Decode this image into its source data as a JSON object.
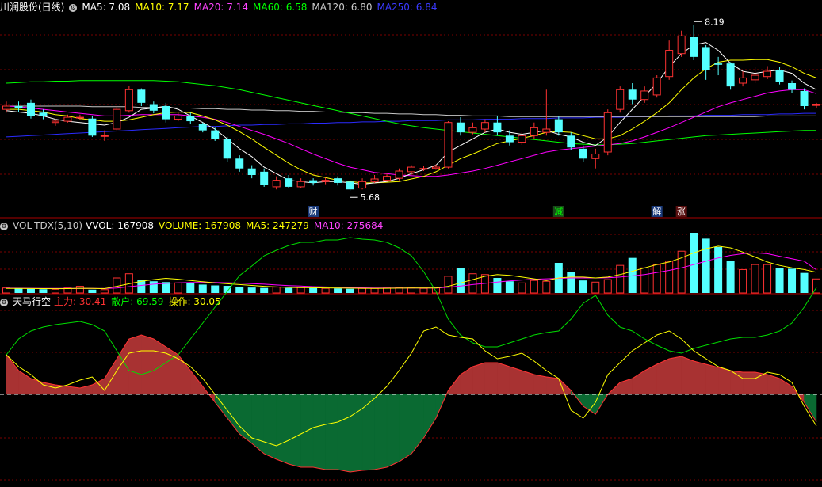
{
  "colors": {
    "up": "#ff3232",
    "down": "#54ffff",
    "ma5": "#ffffff",
    "ma10": "#ffff00",
    "ma20": "#ff00ff",
    "ma60": "#00ff00",
    "ma120": "#c8c8c8",
    "ma250": "#2b2bff",
    "grid": "#7a0000"
  },
  "main": {
    "title": "川润股份(日线)",
    "indicators": [
      {
        "label": "MA5: 7.08",
        "color": "#ffffff"
      },
      {
        "label": "MA10: 7.17",
        "color": "#ffff00"
      },
      {
        "label": "MA20: 7.14",
        "color": "#ff44ff"
      },
      {
        "label": "MA60: 6.58",
        "color": "#00ff00"
      },
      {
        "label": "MA120: 6.80",
        "color": "#c8c8c8"
      },
      {
        "label": "MA250: 6.84",
        "color": "#3a3aff"
      }
    ],
    "high_label": "8.19",
    "low_label": "5.68",
    "event_markers": [
      {
        "text": "财",
        "bg": "#1a3a7a",
        "color": "#ffffff"
      },
      {
        "text": "减",
        "bg": "#1a4a1a",
        "color": "#00ff00"
      },
      {
        "text": "解",
        "bg": "#1a3a7a",
        "color": "#ffffff"
      },
      {
        "text": "涨",
        "bg": "#5a1010",
        "color": "#ffffff"
      }
    ]
  },
  "volume": {
    "title": "VOL-TDX(5,10)",
    "indicators": [
      {
        "label": "VVOL: 167908",
        "color": "#ffffff"
      },
      {
        "label": "VOLUME: 167908",
        "color": "#ffff00"
      },
      {
        "label": "MA5: 247279",
        "color": "#ffff00"
      },
      {
        "label": "MA10: 275684",
        "color": "#ff44ff"
      }
    ]
  },
  "osc": {
    "title": "天马行空",
    "indicators": [
      {
        "label": "主力: 30.41",
        "color": "#ff3232"
      },
      {
        "label": "散户: 69.59",
        "color": "#00ff00"
      },
      {
        "label": "操作: 30.05",
        "color": "#ffff00"
      }
    ]
  },
  "chart_data": {
    "type": "candlestick",
    "candles": [
      [
        6.9,
        6.95,
        7.02,
        6.85
      ],
      [
        6.95,
        6.92,
        7.02,
        6.86
      ],
      [
        7.0,
        6.8,
        7.05,
        6.76
      ],
      [
        6.85,
        6.8,
        6.9,
        6.75
      ],
      [
        6.7,
        6.72,
        6.75,
        6.65
      ],
      [
        6.72,
        6.78,
        6.82,
        6.7
      ],
      [
        6.78,
        6.78,
        6.82,
        6.74
      ],
      [
        6.76,
        6.5,
        6.8,
        6.48
      ],
      [
        6.5,
        6.5,
        6.58,
        6.42
      ],
      [
        6.6,
        6.9,
        6.95,
        6.58
      ],
      [
        6.88,
        7.2,
        7.26,
        6.85
      ],
      [
        7.2,
        7.0,
        7.22,
        6.95
      ],
      [
        6.98,
        6.88,
        7.02,
        6.84
      ],
      [
        6.95,
        6.75,
        7.0,
        6.7
      ],
      [
        6.75,
        6.8,
        6.85,
        6.72
      ],
      [
        6.8,
        6.72,
        6.85,
        6.68
      ],
      [
        6.68,
        6.58,
        6.7,
        6.55
      ],
      [
        6.58,
        6.45,
        6.62,
        6.42
      ],
      [
        6.45,
        6.15,
        6.48,
        6.1
      ],
      [
        6.15,
        6.0,
        6.2,
        5.95
      ],
      [
        6.0,
        5.9,
        6.05,
        5.85
      ],
      [
        5.95,
        5.75,
        6.0,
        5.72
      ],
      [
        5.72,
        5.82,
        5.88,
        5.68
      ],
      [
        5.85,
        5.72,
        5.9,
        5.7
      ],
      [
        5.72,
        5.8,
        5.85,
        5.7
      ],
      [
        5.82,
        5.78,
        5.85,
        5.74
      ],
      [
        5.8,
        5.82,
        5.86,
        5.76
      ],
      [
        5.85,
        5.78,
        5.88,
        5.74
      ],
      [
        5.8,
        5.68,
        5.82,
        5.66
      ],
      [
        5.7,
        5.8,
        5.85,
        5.68
      ],
      [
        5.8,
        5.84,
        5.9,
        5.78
      ],
      [
        5.82,
        5.88,
        5.92,
        5.8
      ],
      [
        5.85,
        5.96,
        6.0,
        5.82
      ],
      [
        5.95,
        6.02,
        6.05,
        5.9
      ],
      [
        6.0,
        6.0,
        6.04,
        5.96
      ],
      [
        6.0,
        6.02,
        6.06,
        5.98
      ],
      [
        6.02,
        6.7,
        6.72,
        6.0
      ],
      [
        6.7,
        6.55,
        6.78,
        6.5
      ],
      [
        6.55,
        6.62,
        6.7,
        6.52
      ],
      [
        6.6,
        6.7,
        6.75,
        6.55
      ],
      [
        6.7,
        6.55,
        6.8,
        6.5
      ],
      [
        6.5,
        6.4,
        6.58,
        6.35
      ],
      [
        6.4,
        6.5,
        6.55,
        6.36
      ],
      [
        6.5,
        6.62,
        6.7,
        6.45
      ],
      [
        6.55,
        6.6,
        7.2,
        6.5
      ],
      [
        6.75,
        6.55,
        6.8,
        6.5
      ],
      [
        6.5,
        6.32,
        6.55,
        6.28
      ],
      [
        6.3,
        6.15,
        6.35,
        6.1
      ],
      [
        6.15,
        6.22,
        6.3,
        6.0
      ],
      [
        6.25,
        6.85,
        6.9,
        6.2
      ],
      [
        6.9,
        7.2,
        7.25,
        6.85
      ],
      [
        7.2,
        7.05,
        7.3,
        6.98
      ],
      [
        7.05,
        7.18,
        7.25,
        7.0
      ],
      [
        7.12,
        7.38,
        7.42,
        7.08
      ],
      [
        7.4,
        7.8,
        7.95,
        7.35
      ],
      [
        7.75,
        8.02,
        8.1,
        7.7
      ],
      [
        8.0,
        7.7,
        8.19,
        7.65
      ],
      [
        7.85,
        7.5,
        7.88,
        7.35
      ],
      [
        7.6,
        7.58,
        7.7,
        7.42
      ],
      [
        7.6,
        7.25,
        7.62,
        7.2
      ],
      [
        7.3,
        7.38,
        7.48,
        7.25
      ],
      [
        7.35,
        7.42,
        7.55,
        7.3
      ],
      [
        7.4,
        7.48,
        7.56,
        7.36
      ],
      [
        7.5,
        7.32,
        7.55,
        7.28
      ],
      [
        7.3,
        7.2,
        7.34,
        7.15
      ],
      [
        7.18,
        6.95,
        7.22,
        6.9
      ],
      [
        6.96,
        6.98,
        7.0,
        6.92
      ]
    ],
    "ma5": [
      6.88,
      6.86,
      6.84,
      6.8,
      6.75,
      6.72,
      6.7,
      6.68,
      6.66,
      6.7,
      6.78,
      6.9,
      6.92,
      6.95,
      6.9,
      6.8,
      6.7,
      6.6,
      6.45,
      6.3,
      6.18,
      6.02,
      5.92,
      5.82,
      5.8,
      5.78,
      5.8,
      5.8,
      5.78,
      5.76,
      5.78,
      5.8,
      5.85,
      5.92,
      5.98,
      6.05,
      6.25,
      6.35,
      6.45,
      6.55,
      6.6,
      6.55,
      6.52,
      6.55,
      6.58,
      6.52,
      6.48,
      6.4,
      6.35,
      6.48,
      6.7,
      6.9,
      7.1,
      7.3,
      7.55,
      7.75,
      7.88,
      7.92,
      7.8,
      7.6,
      7.48,
      7.45,
      7.48,
      7.5,
      7.45,
      7.3,
      7.2
    ],
    "ma10": [
      6.9,
      6.9,
      6.88,
      6.86,
      6.82,
      6.8,
      6.76,
      6.74,
      6.72,
      6.72,
      6.74,
      6.78,
      6.82,
      6.85,
      6.86,
      6.85,
      6.8,
      6.74,
      6.66,
      6.56,
      6.45,
      6.32,
      6.2,
      6.08,
      5.98,
      5.9,
      5.86,
      5.82,
      5.8,
      5.78,
      5.78,
      5.79,
      5.8,
      5.84,
      5.88,
      5.95,
      6.05,
      6.15,
      6.22,
      6.3,
      6.38,
      6.42,
      6.46,
      6.5,
      6.55,
      6.56,
      6.55,
      6.5,
      6.45,
      6.45,
      6.5,
      6.6,
      6.72,
      6.85,
      7.0,
      7.2,
      7.38,
      7.52,
      7.62,
      7.65,
      7.65,
      7.66,
      7.66,
      7.62,
      7.55,
      7.45,
      7.38
    ],
    "ma20": [
      6.95,
      6.94,
      6.92,
      6.9,
      6.88,
      6.86,
      6.84,
      6.82,
      6.8,
      6.8,
      6.81,
      6.82,
      6.82,
      6.82,
      6.82,
      6.8,
      6.78,
      6.75,
      6.7,
      6.64,
      6.58,
      6.52,
      6.45,
      6.38,
      6.3,
      6.22,
      6.15,
      6.08,
      6.02,
      5.98,
      5.94,
      5.92,
      5.9,
      5.89,
      5.88,
      5.88,
      5.9,
      5.93,
      5.96,
      6.0,
      6.05,
      6.1,
      6.15,
      6.2,
      6.25,
      6.28,
      6.3,
      6.32,
      6.34,
      6.36,
      6.38,
      6.42,
      6.48,
      6.55,
      6.62,
      6.7,
      6.78,
      6.86,
      6.94,
      7.0,
      7.05,
      7.1,
      7.15,
      7.18,
      7.2,
      7.2,
      7.14
    ],
    "ma60": [
      7.3,
      7.31,
      7.32,
      7.32,
      7.33,
      7.33,
      7.34,
      7.34,
      7.34,
      7.34,
      7.34,
      7.34,
      7.34,
      7.33,
      7.32,
      7.3,
      7.28,
      7.26,
      7.23,
      7.2,
      7.16,
      7.12,
      7.08,
      7.04,
      7.0,
      6.96,
      6.92,
      6.88,
      6.84,
      6.8,
      6.76,
      6.72,
      6.68,
      6.65,
      6.62,
      6.6,
      6.58,
      6.56,
      6.54,
      6.52,
      6.5,
      6.48,
      6.46,
      6.44,
      6.42,
      6.4,
      6.38,
      6.37,
      6.36,
      6.36,
      6.37,
      6.38,
      6.4,
      6.42,
      6.44,
      6.46,
      6.48,
      6.5,
      6.51,
      6.52,
      6.53,
      6.54,
      6.55,
      6.56,
      6.57,
      6.58,
      6.58
    ],
    "ma120": [
      6.95,
      6.95,
      6.95,
      6.95,
      6.95,
      6.95,
      6.95,
      6.94,
      6.94,
      6.94,
      6.94,
      6.93,
      6.93,
      6.93,
      6.92,
      6.92,
      6.91,
      6.91,
      6.9,
      6.9,
      6.89,
      6.89,
      6.88,
      6.88,
      6.87,
      6.87,
      6.86,
      6.86,
      6.85,
      6.85,
      6.84,
      6.84,
      6.83,
      6.83,
      6.82,
      6.82,
      6.81,
      6.81,
      6.8,
      6.8,
      6.8,
      6.79,
      6.79,
      6.79,
      6.79,
      6.79,
      6.79,
      6.79,
      6.79,
      6.79,
      6.79,
      6.79,
      6.79,
      6.79,
      6.79,
      6.79,
      6.79,
      6.79,
      6.79,
      6.79,
      6.79,
      6.79,
      6.8,
      6.8,
      6.8,
      6.8,
      6.8
    ],
    "ma250": [
      6.48,
      6.49,
      6.5,
      6.51,
      6.52,
      6.53,
      6.54,
      6.55,
      6.56,
      6.57,
      6.58,
      6.59,
      6.6,
      6.61,
      6.62,
      6.63,
      6.64,
      6.64,
      6.65,
      6.66,
      6.66,
      6.67,
      6.67,
      6.68,
      6.68,
      6.69,
      6.69,
      6.7,
      6.7,
      6.71,
      6.71,
      6.72,
      6.72,
      6.73,
      6.73,
      6.73,
      6.74,
      6.74,
      6.74,
      6.75,
      6.75,
      6.75,
      6.76,
      6.76,
      6.76,
      6.77,
      6.77,
      6.77,
      6.78,
      6.78,
      6.78,
      6.79,
      6.79,
      6.79,
      6.8,
      6.8,
      6.8,
      6.81,
      6.81,
      6.81,
      6.82,
      6.82,
      6.82,
      6.83,
      6.83,
      6.84,
      6.84
    ],
    "volumes": [
      60,
      55,
      50,
      45,
      45,
      60,
      80,
      40,
      40,
      180,
      230,
      160,
      140,
      130,
      120,
      120,
      100,
      90,
      85,
      70,
      65,
      60,
      70,
      60,
      65,
      60,
      55,
      55,
      50,
      55,
      55,
      60,
      65,
      60,
      55,
      60,
      200,
      300,
      230,
      220,
      180,
      140,
      120,
      150,
      140,
      360,
      250,
      150,
      130,
      160,
      330,
      420,
      300,
      340,
      380,
      500,
      720,
      650,
      550,
      380,
      280,
      340,
      340,
      300,
      290,
      240,
      167.9
    ],
    "vol_ma5": [
      55,
      54,
      53,
      52,
      51,
      52,
      56,
      54,
      52,
      80,
      110,
      140,
      160,
      175,
      165,
      150,
      135,
      120,
      110,
      100,
      90,
      80,
      72,
      66,
      64,
      63,
      61,
      60,
      58,
      56,
      55,
      56,
      58,
      59,
      60,
      60,
      80,
      120,
      160,
      200,
      220,
      210,
      190,
      170,
      150,
      180,
      190,
      190,
      180,
      190,
      220,
      260,
      300,
      340,
      370,
      420,
      480,
      530,
      560,
      540,
      490,
      430,
      370,
      330,
      300,
      280,
      247.3
    ],
    "vol_ma10": [
      58,
      57,
      56,
      55,
      54,
      54,
      55,
      54,
      53,
      60,
      75,
      90,
      105,
      115,
      120,
      125,
      125,
      125,
      122,
      118,
      112,
      105,
      96,
      88,
      82,
      76,
      72,
      68,
      65,
      62,
      60,
      60,
      60,
      60,
      60,
      60,
      68,
      82,
      100,
      115,
      130,
      145,
      155,
      165,
      170,
      175,
      180,
      180,
      180,
      182,
      190,
      205,
      220,
      245,
      270,
      300,
      340,
      380,
      420,
      450,
      470,
      480,
      470,
      440,
      410,
      380,
      275.7
    ],
    "zhuli": [
      50,
      30,
      20,
      15,
      12,
      10,
      8,
      12,
      20,
      45,
      70,
      75,
      70,
      60,
      50,
      30,
      10,
      -10,
      -30,
      -50,
      -62,
      -75,
      -82,
      -88,
      -92,
      -92,
      -95,
      -95,
      -98,
      -96,
      -95,
      -92,
      -85,
      -75,
      -55,
      -30,
      5,
      25,
      35,
      40,
      40,
      35,
      30,
      25,
      22,
      20,
      5,
      -15,
      -25,
      0,
      15,
      20,
      30,
      38,
      45,
      48,
      42,
      38,
      34,
      30,
      28,
      28,
      25,
      20,
      10,
      -10,
      -35
    ],
    "sanhu": [
      50,
      70,
      80,
      85,
      88,
      90,
      92,
      88,
      80,
      55,
      30,
      25,
      30,
      40,
      50,
      70,
      90,
      110,
      130,
      150,
      162,
      175,
      182,
      188,
      192,
      192,
      195,
      195,
      198,
      196,
      195,
      192,
      185,
      175,
      155,
      130,
      95,
      75,
      65,
      60,
      60,
      65,
      70,
      75,
      78,
      80,
      95,
      115,
      125,
      100,
      85,
      80,
      70,
      62,
      55,
      52,
      58,
      62,
      66,
      70,
      72,
      72,
      75,
      80,
      90,
      110,
      135
    ],
    "caozuo": [
      50,
      35,
      25,
      12,
      8,
      12,
      18,
      22,
      5,
      30,
      52,
      55,
      55,
      52,
      45,
      35,
      20,
      0,
      -20,
      -40,
      -55,
      -60,
      -65,
      -58,
      -50,
      -42,
      -38,
      -35,
      -28,
      -18,
      -5,
      10,
      30,
      52,
      80,
      85,
      75,
      72,
      70,
      55,
      45,
      48,
      52,
      42,
      30,
      20,
      -20,
      -30,
      -10,
      25,
      40,
      55,
      65,
      75,
      80,
      70,
      55,
      45,
      35,
      30,
      20,
      20,
      28,
      25,
      15,
      -15,
      -40
    ]
  }
}
